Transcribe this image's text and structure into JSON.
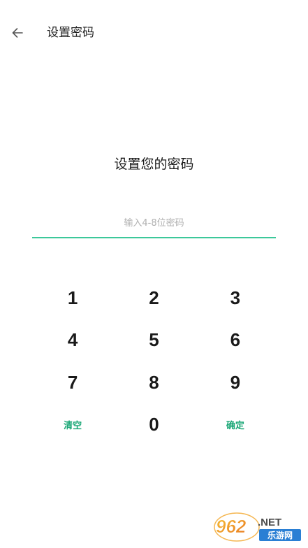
{
  "header": {
    "back_icon": "arrow-left-icon",
    "title": "设置密码"
  },
  "prompt": "设置您的密码",
  "password_field": {
    "value": "",
    "placeholder": "输入4-8位密码"
  },
  "keypad": {
    "rows": [
      [
        "1",
        "2",
        "3"
      ],
      [
        "4",
        "5",
        "6"
      ],
      [
        "7",
        "8",
        "9"
      ]
    ],
    "clear_label": "清空",
    "zero_label": "0",
    "confirm_label": "确定"
  },
  "watermark": {
    "brand": "962.NET",
    "sub": "乐游网"
  },
  "colors": {
    "accent": "#3cc89a",
    "action_text": "#1aa776",
    "text": "#1a1a1a",
    "placeholder": "#b0b0b0"
  }
}
